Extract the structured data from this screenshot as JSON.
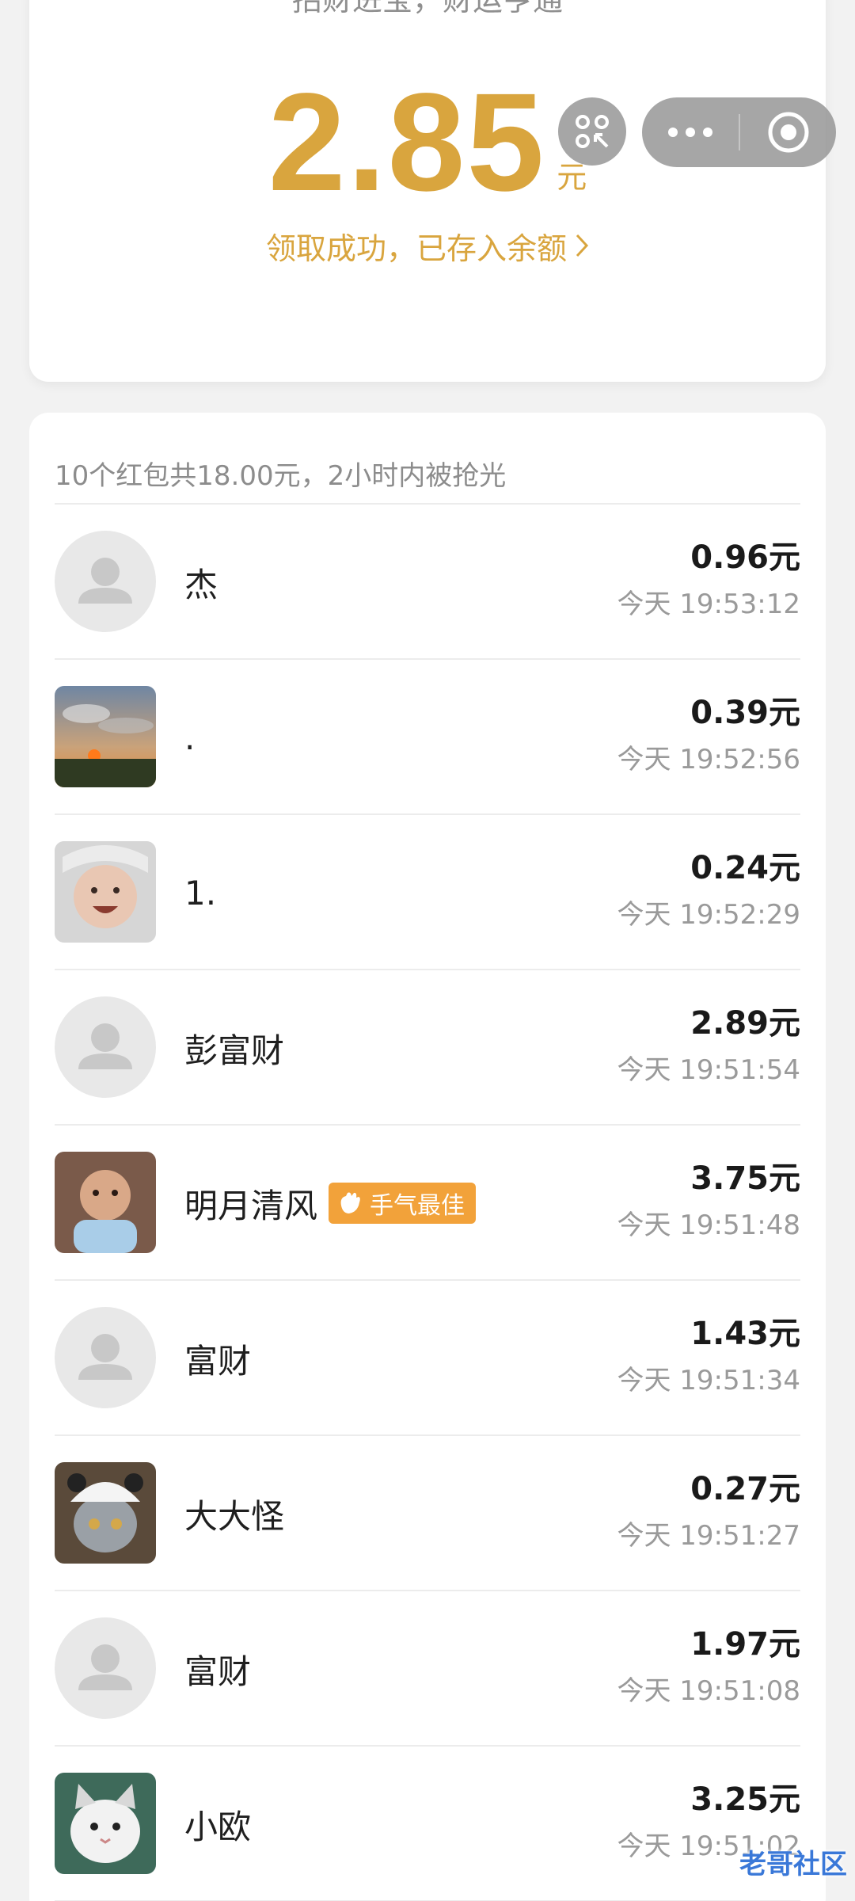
{
  "header": {
    "greeting": "招财进宝，财运亨通",
    "amount": "2.85",
    "unit": "元",
    "received_text": "领取成功，已存入余额"
  },
  "capsule": {
    "scan_icon": "scan-icon",
    "more_icon": "more-dots-icon",
    "close_icon": "close-target-icon"
  },
  "summary": "10个红包共18.00元，2小时内被抢光",
  "records": [
    {
      "name": "杰",
      "amount": "0.96元",
      "time": "今天 19:53:12",
      "avatar": "default"
    },
    {
      "name": ".",
      "amount": "0.39元",
      "time": "今天 19:52:56",
      "avatar": "sunset"
    },
    {
      "name": "1.",
      "amount": "0.24元",
      "time": "今天 19:52:29",
      "avatar": "baby"
    },
    {
      "name": "彭富财",
      "amount": "2.89元",
      "time": "今天 19:51:54",
      "avatar": "default"
    },
    {
      "name": "明月清风",
      "amount": "3.75元",
      "time": "今天 19:51:48",
      "avatar": "kid",
      "badge": "手气最佳"
    },
    {
      "name": "富财",
      "amount": "1.43元",
      "time": "今天 19:51:34",
      "avatar": "default"
    },
    {
      "name": "大大怪",
      "amount": "0.27元",
      "time": "今天 19:51:27",
      "avatar": "cat-panda"
    },
    {
      "name": "富财",
      "amount": "1.97元",
      "time": "今天 19:51:08",
      "avatar": "default"
    },
    {
      "name": "小欧",
      "amount": "3.25元",
      "time": "今天 19:51:02",
      "avatar": "cat"
    }
  ],
  "watermark": "老哥社区",
  "colors": {
    "gold": "#d9a53e",
    "badge": "#f2a23a"
  }
}
